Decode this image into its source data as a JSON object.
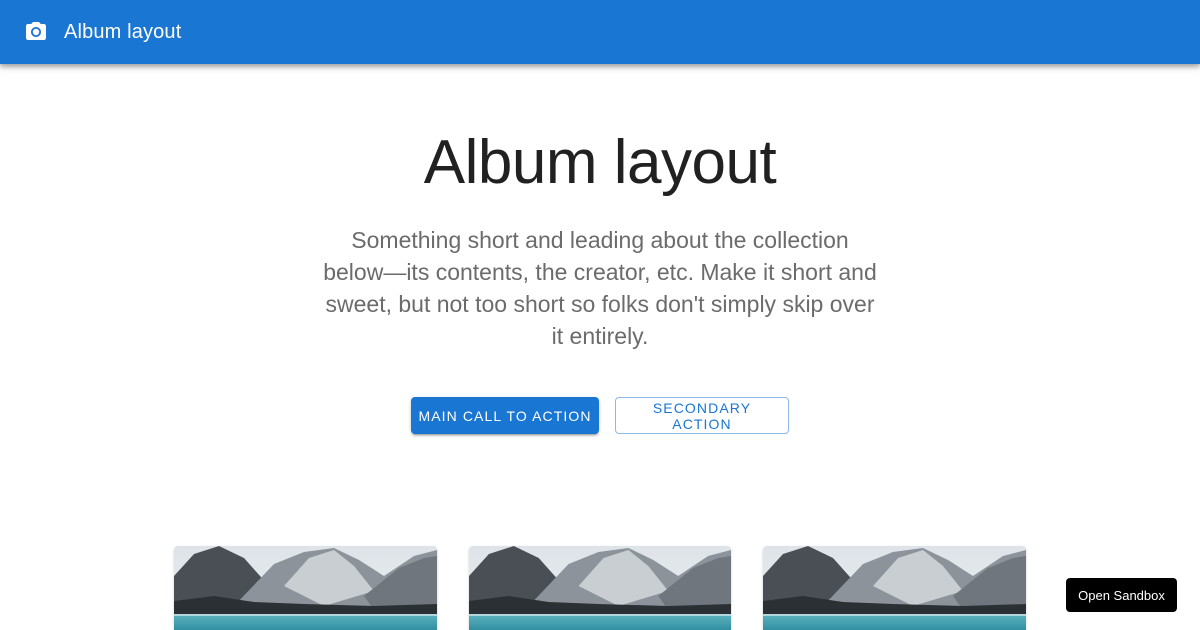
{
  "appbar": {
    "icon": "camera-icon",
    "title": "Album layout",
    "background_color": "#1976d2"
  },
  "hero": {
    "title": "Album layout",
    "subtitle": "Something short and leading about the collection below—its contents, the creator, etc. Make it short and sweet, but not too short so folks don't simply skip over it entirely."
  },
  "actions": {
    "primary_label": "Main call to action",
    "secondary_label": "Secondary action"
  },
  "cards": [
    {
      "image": "mountain-lake-image"
    },
    {
      "image": "mountain-lake-image"
    },
    {
      "image": "mountain-lake-image"
    }
  ],
  "sandbox": {
    "label": "Open Sandbox"
  },
  "colors": {
    "primary": "#1976d2",
    "text_dark": "#212121",
    "text_secondary": "#6b6b6b"
  }
}
